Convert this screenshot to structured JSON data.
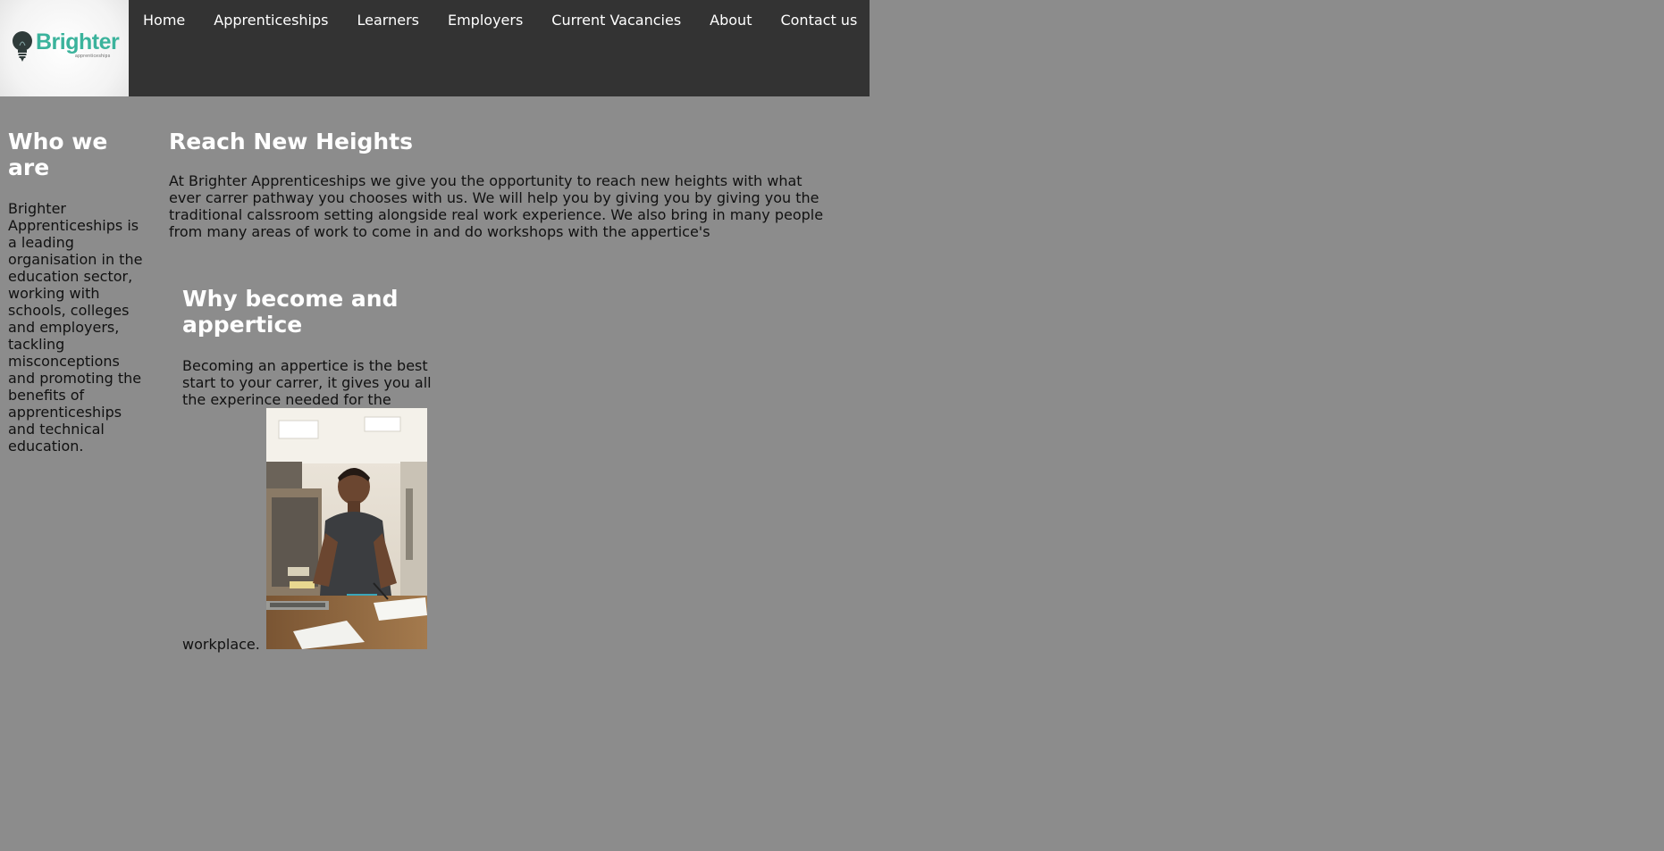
{
  "header": {
    "logo": {
      "wordmark": "Brighter",
      "subtext": "apprenticeships"
    },
    "nav": [
      {
        "label": "Home"
      },
      {
        "label": "Apprenticeships"
      },
      {
        "label": "Learners"
      },
      {
        "label": "Employers"
      },
      {
        "label": "Current Vacancies"
      },
      {
        "label": "About"
      },
      {
        "label": "Contact us"
      }
    ]
  },
  "sidebar": {
    "heading": "Who we are",
    "body": "Brighter Apprenticeships is a leading organisation in the education sector, working with schools, colleges and employers, tackling misconceptions and promoting the benefits of apprenticeships and technical education."
  },
  "main": {
    "heading": "Reach New Heights",
    "body": "At Brighter Apprenticeships we give you the opportunity to reach new heights with what ever carrer pathway you chooses with us. We will help you by giving you by giving you the traditional calssroom setting alongside real work experience. We also bring in many people from many areas of work to come in and do workshops with the appertice's"
  },
  "why": {
    "heading": "Why become and appertice",
    "body": "Becoming an appertice is the best start to your carrer, it gives you all the experince needed for the workplace."
  },
  "colors": {
    "page_bg": "#8c8c8c",
    "header_bg": "#333333",
    "brand_teal": "#3bb39c",
    "heading_text": "#ffffff",
    "body_text": "#111111"
  }
}
